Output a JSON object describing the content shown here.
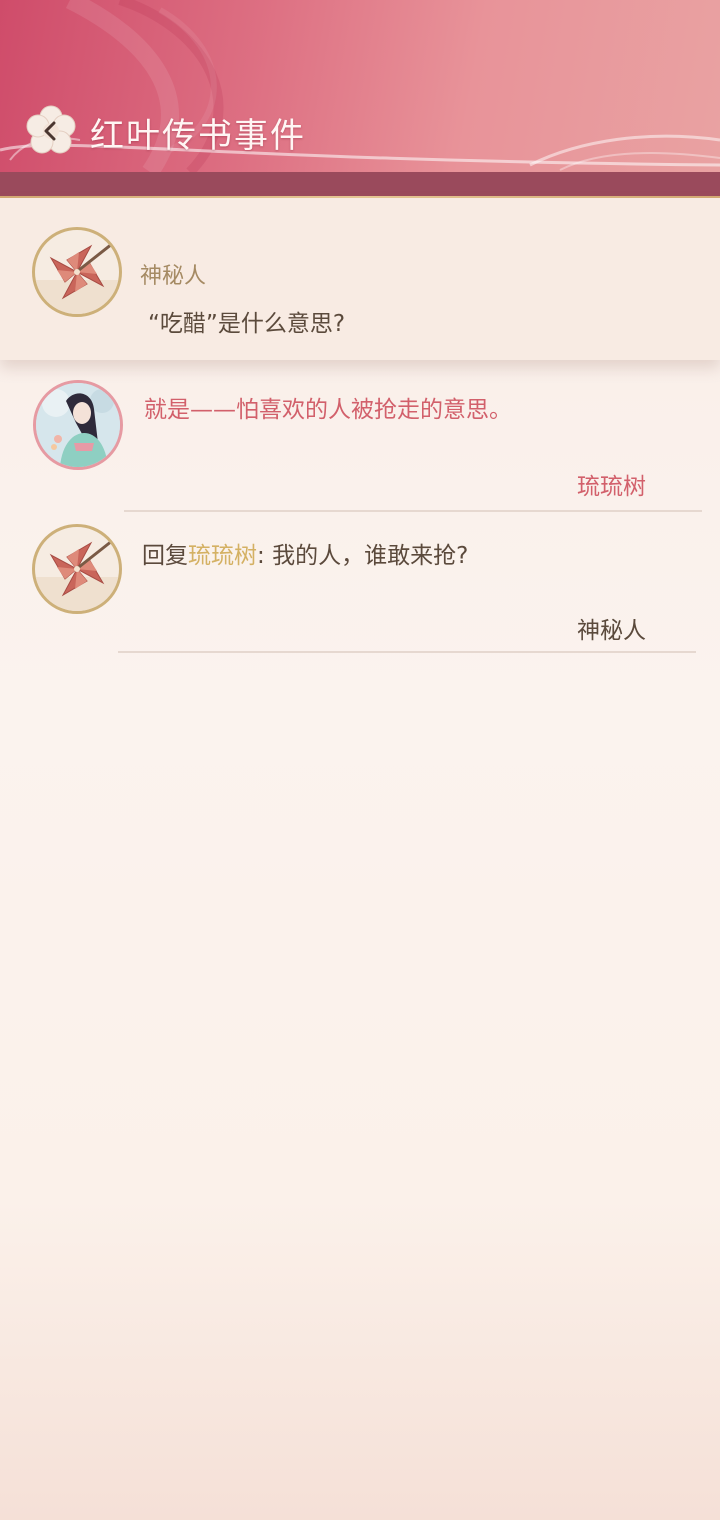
{
  "header": {
    "title": "红叶传书事件",
    "back_icon": "back-chevron-flower-icon",
    "colors": {
      "primary": "#cf4c6a",
      "band": "#9a4a5c"
    }
  },
  "post": {
    "author": "神秘人",
    "content": "“吃醋”是什么意思?",
    "avatar_icon": "pinwheel-avatar"
  },
  "replies": [
    {
      "content": "就是——怕喜欢的人被抢走的意思。",
      "signature": "琉琉树",
      "avatar_icon": "character-portrait-avatar",
      "color": "#d2606b"
    },
    {
      "reply_prefix": "回复",
      "mention": "琉琉树",
      "separator": ": ",
      "content": "我的人，谁敢来抢?",
      "signature": "神秘人",
      "avatar_icon": "pinwheel-avatar",
      "mention_color": "#d4b163"
    }
  ]
}
